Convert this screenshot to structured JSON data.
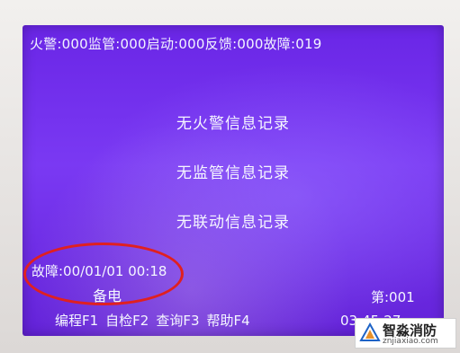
{
  "status_bar": {
    "fire_alarm": "火警:000",
    "supervision": "监管:000",
    "startup": "启动:000",
    "feedback": "反馈:000",
    "fault": "故障:019"
  },
  "records": [
    {
      "text": "无火警信息记录"
    },
    {
      "text": "无监管信息记录"
    },
    {
      "text": "无联动信息记录"
    }
  ],
  "fault_detail": {
    "label_datetime": "故障:00/01/01 00:18",
    "type": "备电",
    "page": "第:001"
  },
  "function_keys": [
    {
      "label": "编程F1"
    },
    {
      "label": "自检F2"
    },
    {
      "label": "查询F3"
    },
    {
      "label": "帮助F4"
    }
  ],
  "clock": "03:45:27",
  "watermark": {
    "name": "智淼消防",
    "url": "znjiaxiao.com"
  },
  "colors": {
    "screen": "#6a26e6",
    "text": "#f2f4ff",
    "annotation": "#e02020"
  }
}
